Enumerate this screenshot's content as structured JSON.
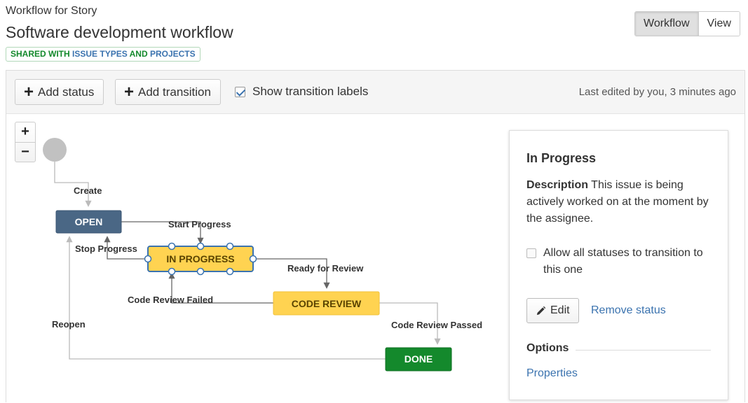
{
  "header": {
    "subtitle": "Workflow for Story",
    "title": "Software development workflow",
    "badge_part1": "SHARED WITH",
    "badge_part2": "ISSUE TYPES",
    "badge_part3": "AND",
    "badge_part4": "PROJECTS"
  },
  "view_toggle": {
    "workflow_label": "Workflow",
    "view_label": "View",
    "active": "Workflow"
  },
  "toolbar": {
    "add_status_label": "Add status",
    "add_transition_label": "Add transition",
    "show_labels_label": "Show transition labels",
    "show_labels_checked": true,
    "last_edited": "Last edited by you, 3 minutes ago"
  },
  "zoom": {
    "in_label": "+",
    "out_label": "−"
  },
  "diagram": {
    "statuses": {
      "open": "OPEN",
      "in_progress": "IN PROGRESS",
      "code_review": "CODE REVIEW",
      "done": "DONE"
    },
    "transitions": {
      "create": "Create",
      "start_progress": "Start Progress",
      "stop_progress": "Stop Progress",
      "ready_for_review": "Ready for Review",
      "code_review_failed": "Code Review Failed",
      "code_review_passed": "Code Review Passed",
      "reopen": "Reopen"
    },
    "colors": {
      "open": "#4a6785",
      "in_progress": "#ffd351",
      "code_review": "#ffd351",
      "done": "#14892c",
      "selection": "#3b73af",
      "start_node": "#c1c1c1"
    }
  },
  "side_panel": {
    "title": "In Progress",
    "description_label": "Description",
    "description_text": "This issue is being actively worked on at the moment by the assignee.",
    "allow_all_label": "Allow all statuses to transition to this one",
    "allow_all_checked": false,
    "edit_label": "Edit",
    "remove_label": "Remove status",
    "options_heading": "Options",
    "properties_label": "Properties"
  }
}
